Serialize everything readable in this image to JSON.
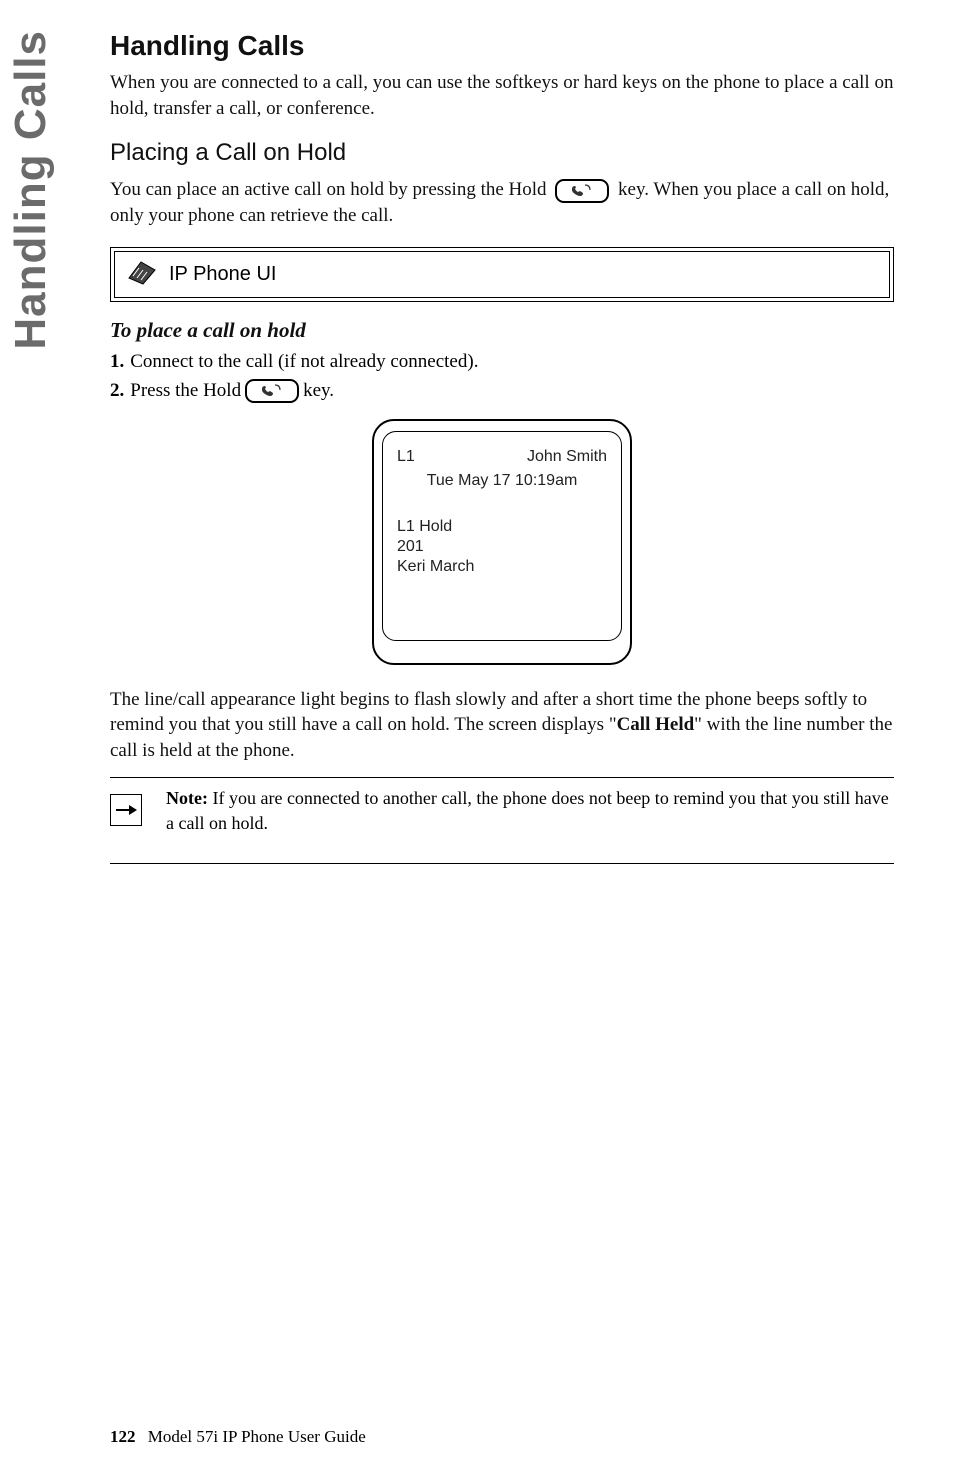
{
  "sideTab": "Handling Calls",
  "title": "Handling Calls",
  "intro": "When you are connected to a call, you can use the softkeys or hard keys on the phone to place a call on hold, transfer a call, or conference.",
  "subheading": "Placing a Call on Hold",
  "hold_para_a": "You can place an active call on hold by pressing the Hold ",
  "hold_para_b": " key. When you place a call on hold, only your phone can retrieve the call.",
  "panel_label": "IP Phone UI",
  "procedure_title": "To place a call on hold",
  "steps": {
    "s1_num": "1.",
    "s1_text": "Connect to the call (if not already connected).",
    "s2_num": "2.",
    "s2_text_a": "Press the Hold ",
    "s2_text_b": " key."
  },
  "screen": {
    "line": "L1",
    "name": "John Smith",
    "datetime": "Tue May 17 10:19am",
    "hold_line": "L1 Hold",
    "ext": "201",
    "caller": "Keri March"
  },
  "after_para_a": "The line/call appearance light begins to flash slowly and after a short time the phone beeps softly to remind you that you still have a call on hold. The screen displays \"",
  "after_para_bold": "Call Held",
  "after_para_b": "\" with the line number the call is held at the phone.",
  "note": {
    "label": "Note:",
    "text": " If you are connected to another call, the phone does not beep to remind you that you still have a call on hold."
  },
  "footer": {
    "page": "122",
    "title": "Model 57i IP Phone User Guide"
  }
}
